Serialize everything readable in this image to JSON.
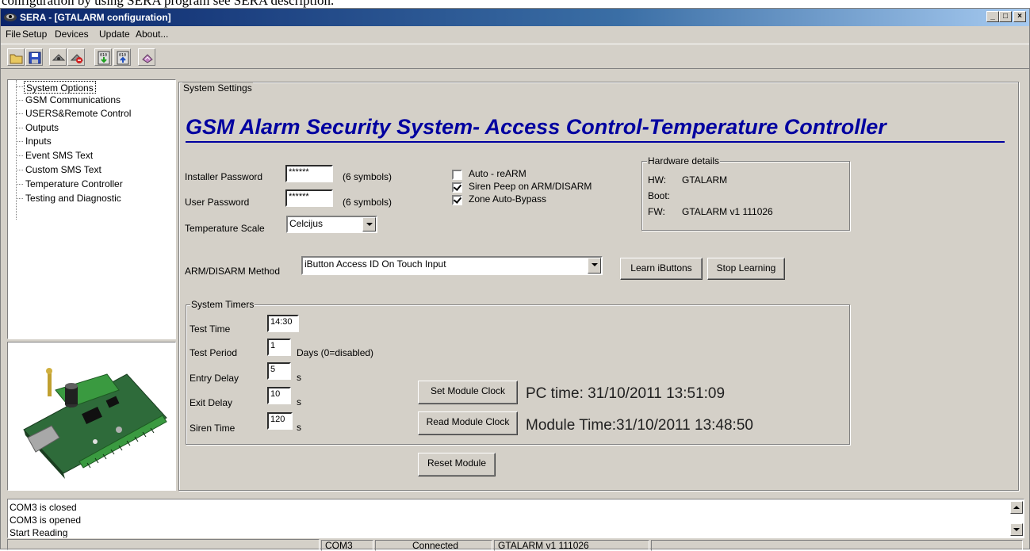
{
  "doc_text": "configuration by using SERA program see SERA description.",
  "window": {
    "title": "SERA - [GTALARM configuration]",
    "controls": [
      "_",
      "□",
      "×"
    ]
  },
  "menu": {
    "file": "File",
    "setup": "Setup",
    "devices": "Devices",
    "update": "Update",
    "about": "About..."
  },
  "toolbar": {
    "icons": [
      "open-folder-icon",
      "save-disk-icon",
      "connect-icon",
      "disconnect-icon",
      "download-icon",
      "upload-icon",
      "eraser-icon"
    ]
  },
  "tree": {
    "items": [
      {
        "label": "System Options"
      },
      {
        "label": "GSM Communications"
      },
      {
        "label": "USERS&Remote Control"
      },
      {
        "label": "Outputs"
      },
      {
        "label": "Inputs"
      },
      {
        "label": "Event SMS Text"
      },
      {
        "label": "Custom SMS Text"
      },
      {
        "label": "Temperature Controller"
      },
      {
        "label": "Testing and Diagnostic"
      }
    ]
  },
  "settings": {
    "group_title": "System Settings",
    "headline": "GSM Alarm Security System- Access Control-Temperature Controller",
    "installer_password_label": "Installer Password",
    "installer_password_value": "******",
    "installer_password_hint": "(6 symbols)",
    "user_password_label": "User Password",
    "user_password_value": "******",
    "user_password_hint": "(6 symbols)",
    "temperature_scale_label": "Temperature Scale",
    "temperature_scale_value": "Celcijus",
    "auto_rearm_label": "Auto - reARM",
    "auto_rearm_checked": false,
    "siren_peep_label": "Siren Peep on ARM/DISARM",
    "siren_peep_checked": true,
    "zone_bypass_label": "Zone Auto-Bypass",
    "zone_bypass_checked": true,
    "hardware": {
      "title": "Hardware details",
      "hw_label": "HW:",
      "hw_value": "GTALARM",
      "boot_label": "Boot:",
      "boot_value": "",
      "fw_label": "FW:",
      "fw_value": "GTALARM v1 111026"
    },
    "arm_method_label": "ARM/DISARM Method",
    "arm_method_value": "iButton Access ID On Touch Input",
    "learn_button": "Learn iButtons",
    "stop_button": "Stop Learning"
  },
  "timers": {
    "group_title": "System Timers",
    "test_time_label": "Test Time",
    "test_time_value": "14:30",
    "test_period_label": "Test Period",
    "test_period_value": "1",
    "test_period_unit": "Days (0=disabled)",
    "entry_delay_label": "Entry Delay",
    "entry_delay_value": "5",
    "entry_delay_unit": "s",
    "exit_delay_label": "Exit Delay",
    "exit_delay_value": "10",
    "exit_delay_unit": "s",
    "siren_time_label": "Siren Time",
    "siren_time_value": "120",
    "siren_time_unit": "s",
    "set_clock_button": "Set Module Clock",
    "read_clock_button": "Read Module Clock",
    "pc_time_text": "PC time: 31/10/2011 13:51:09",
    "module_time_text": "Module Time:31/10/2011 13:48:50"
  },
  "reset_button": "Reset Module",
  "log": {
    "lines": [
      "COM3 is closed",
      "COM3 is opened",
      "Start Reading"
    ]
  },
  "status": {
    "port": "COM3",
    "connection": "Connected",
    "firmware": "GTALARM v1 111026"
  }
}
